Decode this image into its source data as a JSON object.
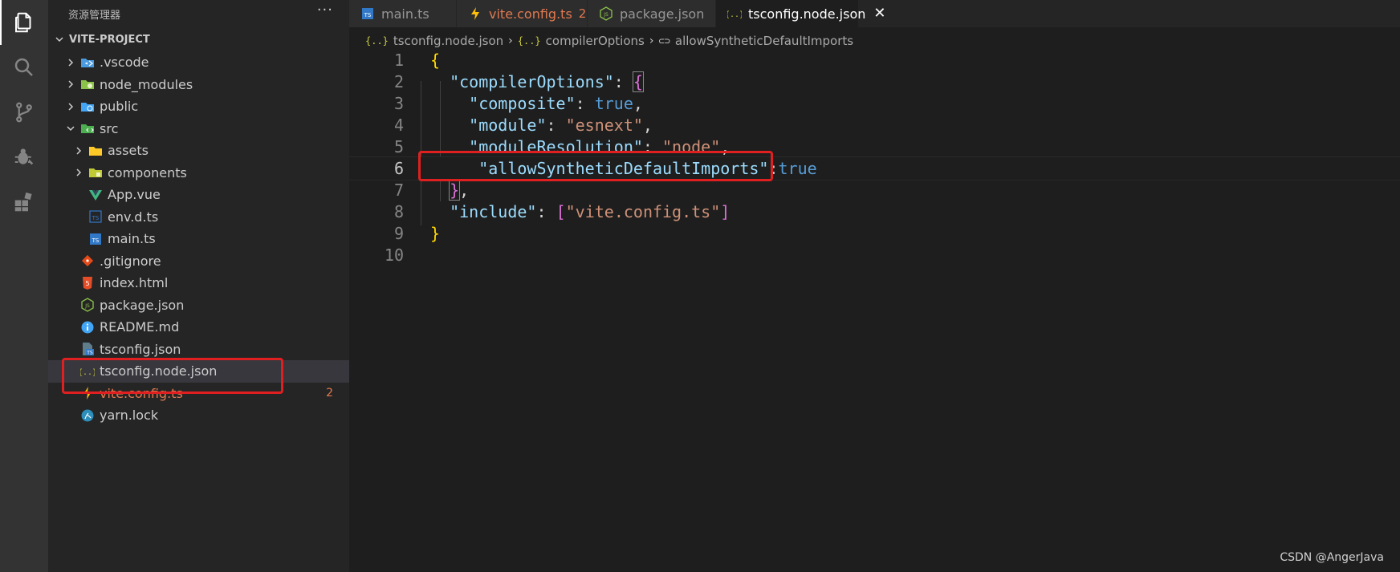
{
  "explorer": {
    "title": "资源管理器",
    "more": "···",
    "project": "VITE-PROJECT",
    "items": [
      {
        "label": ".vscode",
        "icon": "vscode-folder-icon",
        "kind": "folder",
        "expanded": false,
        "depth": 1
      },
      {
        "label": "node_modules",
        "icon": "node-folder-icon",
        "kind": "folder",
        "expanded": false,
        "depth": 1
      },
      {
        "label": "public",
        "icon": "public-folder-icon",
        "kind": "folder",
        "expanded": false,
        "depth": 1
      },
      {
        "label": "src",
        "icon": "src-folder-icon",
        "kind": "folder",
        "expanded": true,
        "depth": 1
      },
      {
        "label": "assets",
        "icon": "assets-folder-icon",
        "kind": "folder",
        "expanded": false,
        "depth": 2
      },
      {
        "label": "components",
        "icon": "components-folder-icon",
        "kind": "folder",
        "expanded": false,
        "depth": 2
      },
      {
        "label": "App.vue",
        "icon": "vue-file-icon",
        "kind": "file",
        "depth": 2
      },
      {
        "label": "env.d.ts",
        "icon": "typescript-def-icon",
        "kind": "file",
        "depth": 2
      },
      {
        "label": "main.ts",
        "icon": "typescript-file-icon",
        "kind": "file",
        "depth": 2
      },
      {
        "label": ".gitignore",
        "icon": "git-icon",
        "kind": "file",
        "depth": 1
      },
      {
        "label": "index.html",
        "icon": "html-file-icon",
        "kind": "file",
        "depth": 1
      },
      {
        "label": "package.json",
        "icon": "nodejs-file-icon",
        "kind": "file",
        "depth": 1
      },
      {
        "label": "README.md",
        "icon": "info-icon",
        "kind": "file",
        "depth": 1
      },
      {
        "label": "tsconfig.json",
        "icon": "tsconfig-file-icon",
        "kind": "file",
        "depth": 1
      },
      {
        "label": "tsconfig.node.json",
        "icon": "json-file-icon",
        "kind": "file",
        "depth": 1,
        "selected": true
      },
      {
        "label": "vite.config.ts",
        "icon": "vite-file-icon",
        "kind": "file",
        "depth": 1,
        "modified": true,
        "badge": "2"
      },
      {
        "label": "yarn.lock",
        "icon": "yarn-file-icon",
        "kind": "file",
        "depth": 1
      }
    ]
  },
  "tabs": [
    {
      "label": "main.ts",
      "icon": "typescript-file-icon",
      "active": false
    },
    {
      "label": "vite.config.ts",
      "icon": "vite-file-icon",
      "active": false,
      "modified": true,
      "badge": "2"
    },
    {
      "label": "package.json",
      "icon": "nodejs-file-icon",
      "active": false
    },
    {
      "label": "tsconfig.node.json",
      "icon": "json-file-icon",
      "active": true,
      "close": "✕"
    }
  ],
  "breadcrumb": [
    {
      "icon": "{..}",
      "label": "tsconfig.node.json"
    },
    {
      "icon": "{..}",
      "label": "compilerOptions"
    },
    {
      "icon": "⊂⊃",
      "label": "allowSyntheticDefaultImports"
    }
  ],
  "code": {
    "current_line": 6,
    "lines": [
      {
        "n": "1",
        "tokens": [
          {
            "t": "{",
            "c": "brace1"
          }
        ]
      },
      {
        "n": "2",
        "tokens": [
          {
            "t": "  ",
            "c": "punct"
          },
          {
            "t": "\"compilerOptions\"",
            "c": "key"
          },
          {
            "t": ": ",
            "c": "punct"
          },
          {
            "t": "{",
            "c": "brace2"
          }
        ]
      },
      {
        "n": "3",
        "tokens": [
          {
            "t": "    ",
            "c": "punct"
          },
          {
            "t": "\"composite\"",
            "c": "key"
          },
          {
            "t": ": ",
            "c": "punct"
          },
          {
            "t": "true",
            "c": "kw"
          },
          {
            "t": ",",
            "c": "punct"
          }
        ]
      },
      {
        "n": "4",
        "tokens": [
          {
            "t": "    ",
            "c": "punct"
          },
          {
            "t": "\"module\"",
            "c": "key"
          },
          {
            "t": ": ",
            "c": "punct"
          },
          {
            "t": "\"esnext\"",
            "c": "str"
          },
          {
            "t": ",",
            "c": "punct"
          }
        ]
      },
      {
        "n": "5",
        "tokens": [
          {
            "t": "    ",
            "c": "punct"
          },
          {
            "t": "\"moduleResolution\"",
            "c": "key"
          },
          {
            "t": ": ",
            "c": "punct"
          },
          {
            "t": "\"node\"",
            "c": "str"
          },
          {
            "t": ",",
            "c": "punct"
          }
        ]
      },
      {
        "n": "6",
        "tokens": [
          {
            "t": "     ",
            "c": "punct"
          },
          {
            "t": "\"allowSyntheticDefaultImports\"",
            "c": "key"
          },
          {
            "t": ":",
            "c": "punct"
          },
          {
            "t": "true",
            "c": "kw"
          }
        ]
      },
      {
        "n": "7",
        "tokens": [
          {
            "t": "  ",
            "c": "punct"
          },
          {
            "t": "}",
            "c": "brace2"
          },
          {
            "t": ",",
            "c": "punct"
          }
        ]
      },
      {
        "n": "8",
        "tokens": [
          {
            "t": "  ",
            "c": "punct"
          },
          {
            "t": "\"include\"",
            "c": "key"
          },
          {
            "t": ": ",
            "c": "punct"
          },
          {
            "t": "[",
            "c": "brace2"
          },
          {
            "t": "\"vite.config.ts\"",
            "c": "str"
          },
          {
            "t": "]",
            "c": "brace2"
          }
        ]
      },
      {
        "n": "9",
        "tokens": [
          {
            "t": "}",
            "c": "brace1"
          }
        ]
      },
      {
        "n": "10",
        "tokens": []
      }
    ]
  },
  "annotation_color": "#e02020",
  "watermark": "CSDN @AngerJava"
}
